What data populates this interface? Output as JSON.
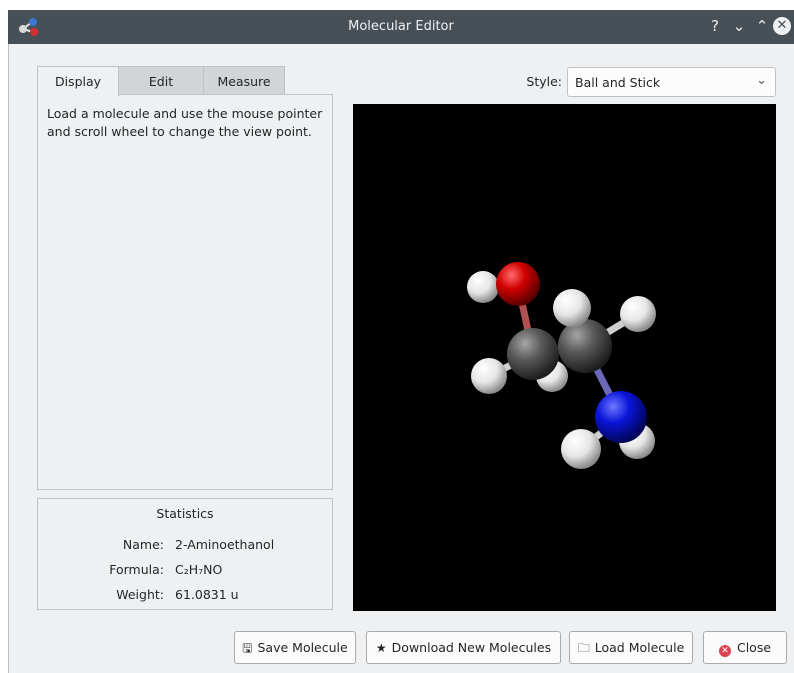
{
  "window": {
    "title": "Molecular Editor",
    "help_glyph": "?",
    "minimize_glyph": "⌄",
    "maximize_glyph": "⌃",
    "close_glyph": "✕"
  },
  "tabs": [
    {
      "label": "Display",
      "active": true
    },
    {
      "label": "Edit",
      "active": false
    },
    {
      "label": "Measure",
      "active": false
    }
  ],
  "display_panel": {
    "instructions": "Load a molecule and use the mouse pointer and scroll wheel to change the view point."
  },
  "statistics": {
    "title": "Statistics",
    "name_label": "Name:",
    "name_value": "2-Aminoethanol",
    "formula_label": "Formula:",
    "formula_value": "C₂H₇NO",
    "weight_label": "Weight:",
    "weight_value": "61.0831 u"
  },
  "style": {
    "label": "Style:",
    "value": "Ball and Stick"
  },
  "viewer": {
    "molecule": "2-Aminoethanol",
    "colors": {
      "background": "#000000",
      "oxygen": "#d10000",
      "carbon": "#5a5a5a",
      "nitrogen": "#0a14d8",
      "hydrogen": "#f2f2f2"
    }
  },
  "buttons": {
    "save": "Save Molecule",
    "download": "Download New Molecules",
    "load": "Load Molecule",
    "close": "Close"
  },
  "icons": {
    "save": "save-icon",
    "download": "star-icon",
    "load": "folder-icon",
    "close": "close-circle-icon"
  }
}
